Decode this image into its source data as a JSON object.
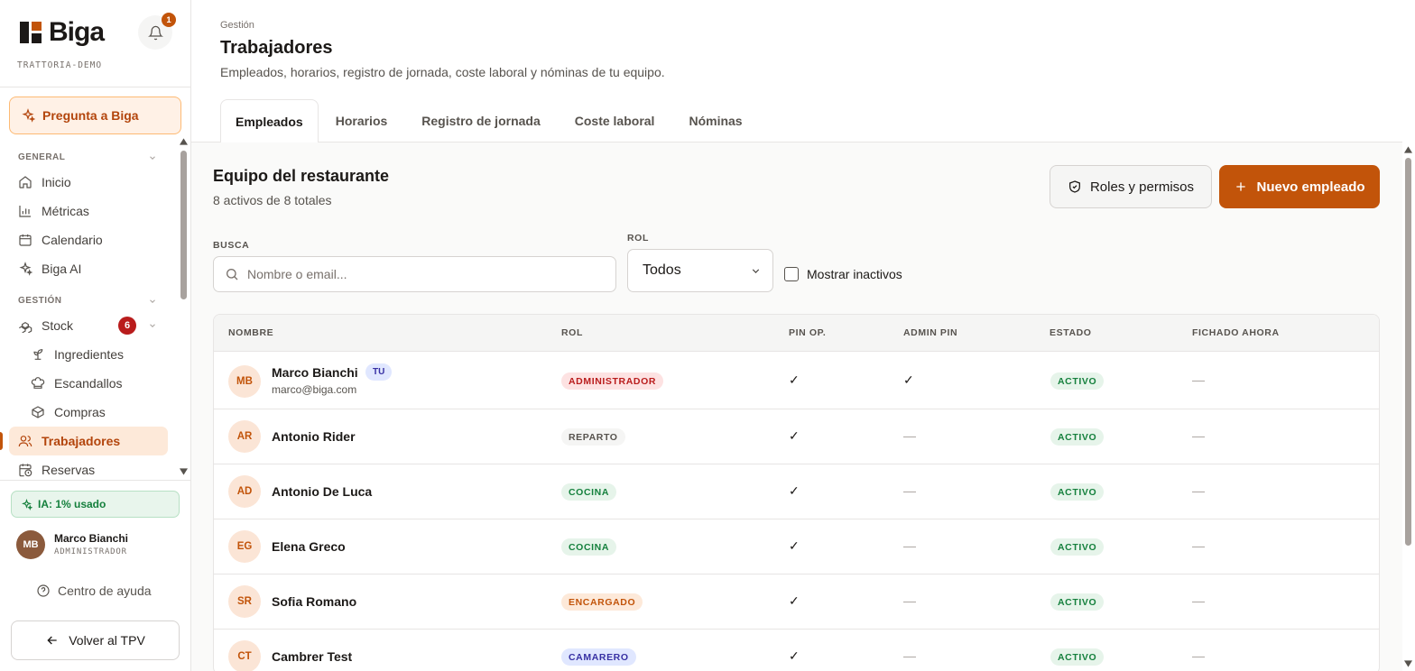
{
  "sidebar": {
    "brand": "Biga",
    "tenant": "TRATTORIA-DEMO",
    "notifications": "1",
    "ask": "Pregunta a Biga",
    "sections": {
      "general": "GENERAL",
      "gestion": "GESTIÓN"
    },
    "items": {
      "inicio": "Inicio",
      "metricas": "Métricas",
      "calendario": "Calendario",
      "biga_ai": "Biga AI",
      "stock": "Stock",
      "stock_badge": "6",
      "ingredientes": "Ingredientes",
      "escandallos": "Escandallos",
      "compras": "Compras",
      "trabajadores": "Trabajadores",
      "reservas": "Reservas"
    },
    "ia_usage": "IA: 1% usado",
    "user": {
      "initials": "MB",
      "name": "Marco Bianchi",
      "role": "ADMINISTRADOR"
    },
    "help": "Centro de ayuda",
    "back": "Volver al TPV"
  },
  "header": {
    "breadcrumb": "Gestión",
    "title": "Trabajadores",
    "subtitle": "Empleados, horarios, registro de jornada, coste laboral y nóminas de tu equipo.",
    "tabs": [
      "Empleados",
      "Horarios",
      "Registro de jornada",
      "Coste laboral",
      "Nóminas"
    ]
  },
  "main": {
    "title": "Equipo del restaurante",
    "subtitle": "8 activos de 8 totales",
    "roles_button": "Roles y permisos",
    "new_button": "Nuevo empleado",
    "search_label": "BUSCA",
    "search_placeholder": "Nombre o email...",
    "role_label": "ROL",
    "role_value": "Todos",
    "inactive_label": "Mostrar inactivos"
  },
  "table": {
    "headers": [
      "NOMBRE",
      "ROL",
      "PIN OP.",
      "ADMIN PIN",
      "ESTADO",
      "FICHADO AHORA"
    ],
    "rows": [
      {
        "initials": "MB",
        "name": "Marco Bianchi",
        "tag": "TU",
        "email": "marco@biga.com",
        "role": "ADMINISTRADOR",
        "pin_op": "✓",
        "admin_pin": "✓",
        "status": "ACTIVO",
        "clocked": "—"
      },
      {
        "initials": "AR",
        "name": "Antonio Rider",
        "role": "REPARTO",
        "pin_op": "✓",
        "admin_pin": "—",
        "status": "ACTIVO",
        "clocked": "—"
      },
      {
        "initials": "AD",
        "name": "Antonio De Luca",
        "role": "COCINA",
        "pin_op": "✓",
        "admin_pin": "—",
        "status": "ACTIVO",
        "clocked": "—"
      },
      {
        "initials": "EG",
        "name": "Elena Greco",
        "role": "COCINA",
        "pin_op": "✓",
        "admin_pin": "—",
        "status": "ACTIVO",
        "clocked": "—"
      },
      {
        "initials": "SR",
        "name": "Sofia Romano",
        "role": "ENCARGADO",
        "pin_op": "✓",
        "admin_pin": "—",
        "status": "ACTIVO",
        "clocked": "—"
      },
      {
        "initials": "CT",
        "name": "Cambrer Test",
        "role": "CAMARERO",
        "pin_op": "✓",
        "admin_pin": "—",
        "status": "ACTIVO",
        "clocked": "—"
      }
    ]
  },
  "colors": {
    "accent": "#c2540a",
    "role_admin": "#b91c1c",
    "role_cocina": "#15803d",
    "role_encargado": "#c2540a",
    "role_camarero": "#3730a3",
    "role_reparto": "#57534e"
  }
}
